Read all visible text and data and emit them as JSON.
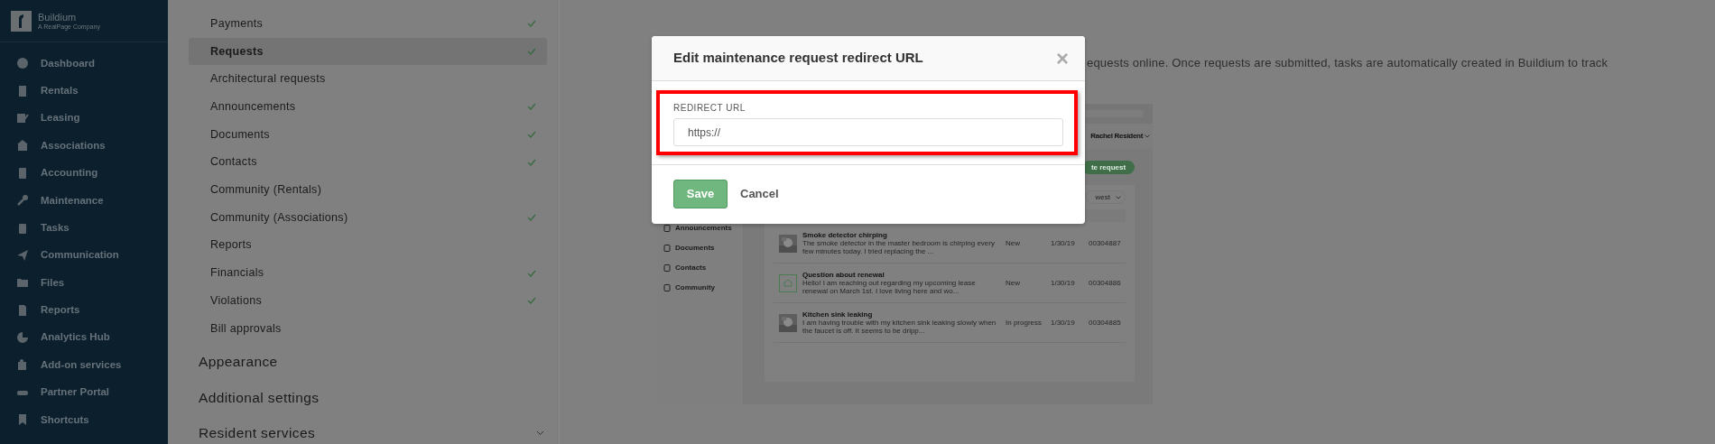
{
  "sidebar": {
    "brand": "Buildium",
    "tagline": "A RealPage Company",
    "items": [
      {
        "label": "Dashboard"
      },
      {
        "label": "Rentals"
      },
      {
        "label": "Leasing"
      },
      {
        "label": "Associations"
      },
      {
        "label": "Accounting"
      },
      {
        "label": "Maintenance"
      },
      {
        "label": "Tasks"
      },
      {
        "label": "Communication"
      },
      {
        "label": "Files"
      },
      {
        "label": "Reports"
      },
      {
        "label": "Analytics Hub"
      },
      {
        "label": "Add-on services"
      },
      {
        "label": "Partner Portal"
      },
      {
        "label": "Shortcuts"
      }
    ]
  },
  "settings": {
    "items": [
      {
        "label": "Payments",
        "checked": true,
        "selected": false
      },
      {
        "label": "Requests",
        "checked": true,
        "selected": true
      },
      {
        "label": "Architectural requests",
        "checked": false,
        "selected": false
      },
      {
        "label": "Announcements",
        "checked": true,
        "selected": false
      },
      {
        "label": "Documents",
        "checked": true,
        "selected": false
      },
      {
        "label": "Contacts",
        "checked": true,
        "selected": false
      },
      {
        "label": "Community (Rentals)",
        "checked": false,
        "selected": false
      },
      {
        "label": "Community (Associations)",
        "checked": true,
        "selected": false
      },
      {
        "label": "Reports",
        "checked": false,
        "selected": false
      },
      {
        "label": "Financials",
        "checked": true,
        "selected": false
      },
      {
        "label": "Violations",
        "checked": true,
        "selected": false
      },
      {
        "label": "Bill approvals",
        "checked": false,
        "selected": false
      }
    ],
    "sections": [
      {
        "label": "Appearance",
        "expandable": false
      },
      {
        "label": "Additional settings",
        "expandable": false
      },
      {
        "label": "Resident services",
        "expandable": true
      }
    ]
  },
  "main": {
    "description": "equests online. Once requests are submitted, tasks are automatically created in Buildium to track",
    "preview": {
      "user": "Rachel Resident",
      "button": "te request",
      "sort": "west",
      "nav": [
        {
          "label": "Announcements"
        },
        {
          "label": "Documents"
        },
        {
          "label": "Contacts"
        },
        {
          "label": "Community"
        }
      ],
      "rows": [
        {
          "kind": "picture",
          "title": "Smoke detector chirping",
          "text": "The smoke detector in the master bedroom is chirping every few minutes today. I tried replacing the ...",
          "status": "New",
          "date": "1/30/19",
          "id": "00304887"
        },
        {
          "kind": "icon",
          "title": "Question about renewal",
          "text": "Hello! I am reaching out regarding my upcoming lease renewal on March 1st. I love living here and wo...",
          "status": "New",
          "date": "1/30/19",
          "id": "00304886"
        },
        {
          "kind": "picture",
          "title": "Kitchen sink leaking",
          "text": "I am having trouble with my kitchen sink leaking slowly when the faucet is off. It seems to be dripp...",
          "status": "In progress",
          "date": "1/30/19",
          "id": "00304885"
        }
      ]
    }
  },
  "dialog": {
    "title": "Edit maintenance request redirect URL",
    "close": "×",
    "field_label": "REDIRECT URL",
    "field_value": "https://",
    "save": "Save",
    "cancel": "Cancel"
  }
}
